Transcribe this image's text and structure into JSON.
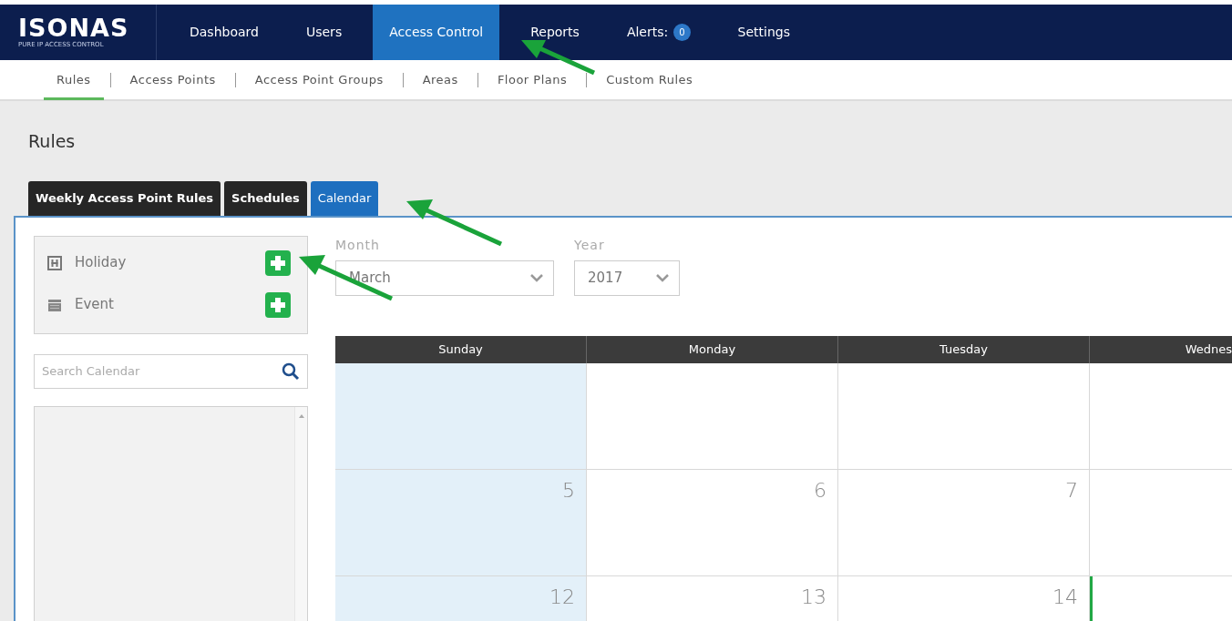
{
  "logo": {
    "name": "ISONAS",
    "tagline": "PURE IP ACCESS CONTROL"
  },
  "nav": [
    {
      "label": "Dashboard",
      "selected": false
    },
    {
      "label": "Users",
      "selected": false
    },
    {
      "label": "Access Control",
      "selected": true
    },
    {
      "label": "Reports",
      "selected": false
    },
    {
      "label": "Alerts:",
      "badge": "0",
      "selected": false
    },
    {
      "label": "Settings",
      "selected": false
    }
  ],
  "subnav": [
    {
      "label": "Rules",
      "selected": true
    },
    {
      "label": "Access Points",
      "selected": false
    },
    {
      "label": "Access Point Groups",
      "selected": false
    },
    {
      "label": "Areas",
      "selected": false
    },
    {
      "label": "Floor Plans",
      "selected": false
    },
    {
      "label": "Custom Rules",
      "selected": false
    }
  ],
  "page_title": "Rules",
  "tabs": [
    {
      "label": "Weekly Access Point Rules",
      "selected": false
    },
    {
      "label": "Schedules",
      "selected": false
    },
    {
      "label": "Calendar",
      "selected": true
    }
  ],
  "add_items": [
    {
      "label": "Holiday",
      "kind": "holiday"
    },
    {
      "label": "Event",
      "kind": "event"
    }
  ],
  "search": {
    "placeholder": "Search Calendar"
  },
  "month": {
    "label": "Month",
    "value": "March"
  },
  "year": {
    "label": "Year",
    "value": "2017"
  },
  "calendar": {
    "columns": [
      {
        "label": "Sunday",
        "shaded": true
      },
      {
        "label": "Monday",
        "shaded": false
      },
      {
        "label": "Tuesday",
        "shaded": false
      },
      {
        "label": "Wednes",
        "shaded": false
      }
    ],
    "weeks": [
      [
        {
          "today": false
        },
        {
          "today": false
        },
        {
          "today": false
        },
        {
          "today": false
        }
      ],
      [
        {
          "day": "5",
          "today": false
        },
        {
          "day": "6",
          "today": false
        },
        {
          "day": "7",
          "today": false
        },
        {
          "today": false
        }
      ],
      [
        {
          "day": "12",
          "today": false
        },
        {
          "day": "13",
          "today": false
        },
        {
          "day": "14",
          "today": false
        },
        {
          "today": true
        }
      ]
    ]
  }
}
